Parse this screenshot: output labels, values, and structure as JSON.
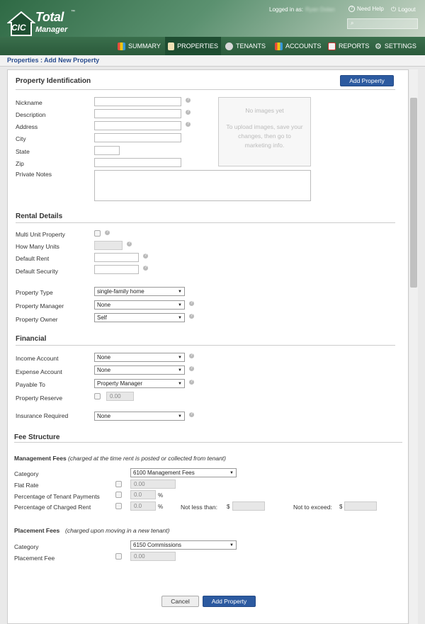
{
  "brand": {
    "badge": "CIC",
    "name_line1": "Total",
    "name_line2": "Manager",
    "tm": "™"
  },
  "header": {
    "logged_in_label": "Logged in as:",
    "user_name": "Ryan Dolan",
    "help": "Need Help",
    "logout": "Logout",
    "search_icon": "search-icon"
  },
  "nav": [
    {
      "label": "SUMMARY",
      "icon": "chart-icon"
    },
    {
      "label": "PROPERTIES",
      "icon": "home-icon"
    },
    {
      "label": "TENANTS",
      "icon": "people-icon"
    },
    {
      "label": "ACCOUNTS",
      "icon": "chart-icon"
    },
    {
      "label": "REPORTS",
      "icon": "document-icon"
    },
    {
      "label": "SETTINGS",
      "icon": "gear-icon"
    }
  ],
  "breadcrumb": "Properties : Add New Property",
  "identification": {
    "title": "Property Identification",
    "add_button": "Add Property",
    "nickname": "Nickname",
    "description": "Description",
    "address": "Address",
    "city": "City",
    "state": "State",
    "zip": "Zip",
    "notes": "Private Notes",
    "images_line1": "No images yet",
    "images_line2": "To upload images, save your changes, then go to marketing info."
  },
  "rental": {
    "title": "Rental Details",
    "multi_unit": "Multi Unit Property",
    "how_many": "How Many Units",
    "default_rent": "Default Rent",
    "default_security": "Default Security",
    "property_type": "Property Type",
    "property_type_value": "single-family home",
    "manager": "Property Manager",
    "manager_value": "None",
    "owner": "Property Owner",
    "owner_value": "Self"
  },
  "financial": {
    "title": "Financial",
    "income": "Income Account",
    "income_value": "None",
    "expense": "Expense Account",
    "expense_value": "None",
    "payable": "Payable To",
    "payable_value": "Property Manager",
    "reserve": "Property Reserve",
    "reserve_value": "0.00",
    "insurance": "Insurance Required",
    "insurance_value": "None"
  },
  "fees": {
    "title": "Fee Structure",
    "mgmt_title": "Management Fees",
    "mgmt_note": "(charged at the time rent is posted or collected from tenant)",
    "category": "Category",
    "mgmt_category_value": "6100 Management Fees",
    "flat_rate": "Flat Rate",
    "flat_value": "0.00",
    "pct_tenant": "Percentage of Tenant Payments",
    "pct_tenant_value": "0.0",
    "pct_charged": "Percentage of Charged Rent",
    "pct_charged_value": "0.0",
    "pct_sign": "%",
    "not_less": "Not less than:",
    "not_exceed": "Not to exceed:",
    "currency": "$",
    "place_title": "Placement Fees",
    "place_note": "(charged upon moving in a new tenant)",
    "place_category_value": "6150 Commissions",
    "placement_fee": "Placement Fee",
    "placement_value": "0.00"
  },
  "footer": {
    "cancel": "Cancel",
    "add": "Add Property"
  },
  "colors": {
    "accent": "#2c5aa0",
    "header_green": "#2f6a45"
  }
}
